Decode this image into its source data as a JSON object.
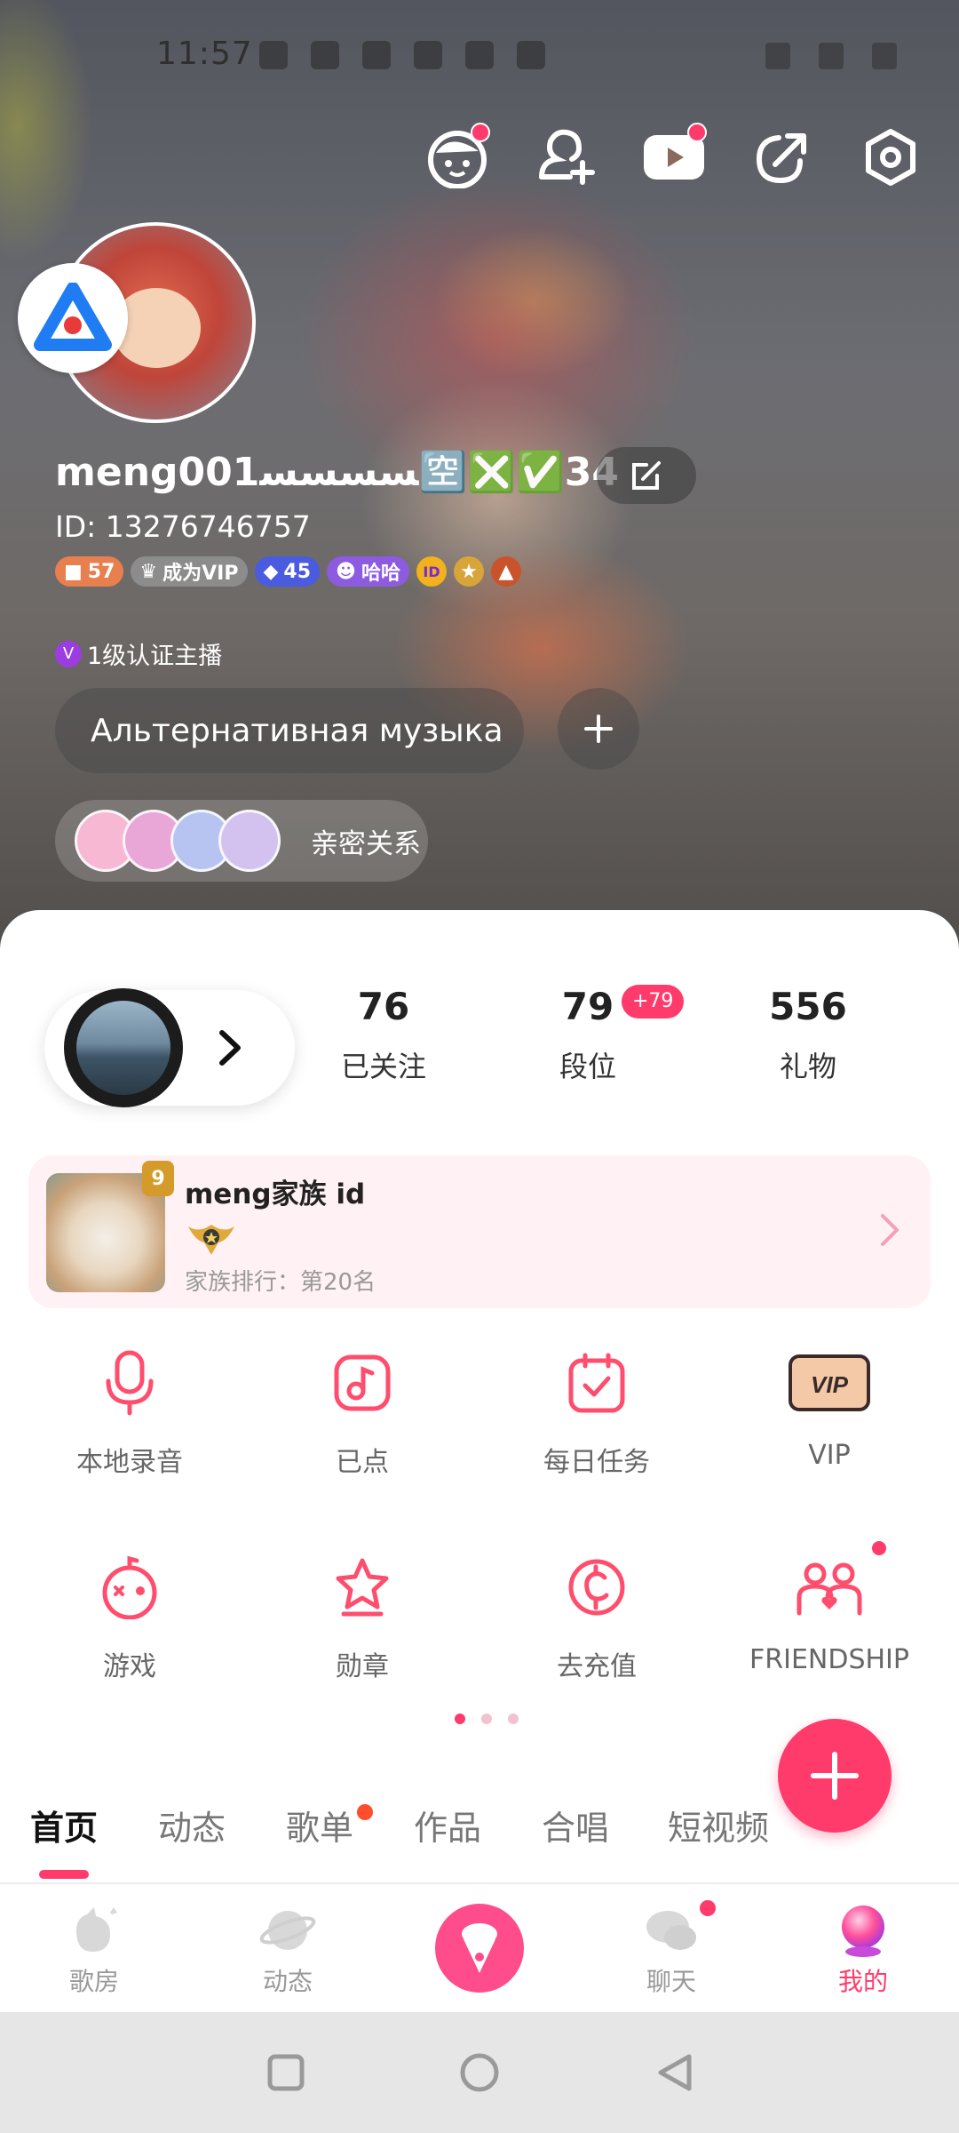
{
  "status_bar": {
    "time": "11:57"
  },
  "profile": {
    "username": "meng001ﺴﺴﺴﺴ🈳❎✅34",
    "id_text": "ID: 13276746757",
    "badges": {
      "level": "57",
      "vip": "成为VIP",
      "rank": "45",
      "tag": "哈哈",
      "id_badge": "ID"
    },
    "anchor": "1级认证主播",
    "anchor_icon": "V",
    "music_tag": "Альтернативная музыка",
    "intimate_label": "亲密关系"
  },
  "stats": [
    {
      "num": "76",
      "label": "已关注"
    },
    {
      "num": "79",
      "label": "段位",
      "badge": "+79"
    },
    {
      "num": "556",
      "label": "礼物"
    }
  ],
  "family": {
    "name": "meng家族 id",
    "level": "9",
    "rank": "家族排行：第20名"
  },
  "grid": [
    {
      "label": "本地录音",
      "icon": "microphone-icon"
    },
    {
      "label": "已点",
      "icon": "music-note-icon"
    },
    {
      "label": "每日任务",
      "icon": "calendar-check-icon"
    },
    {
      "label": "VIP",
      "icon": "vip-card-icon"
    },
    {
      "label": "游戏",
      "icon": "game-robot-icon"
    },
    {
      "label": "勋章",
      "icon": "medal-star-icon"
    },
    {
      "label": "去充值",
      "icon": "coin-icon"
    },
    {
      "label": "FRIENDSHIP",
      "icon": "friends-icon"
    }
  ],
  "tabs": [
    "首页",
    "动态",
    "歌单",
    "作品",
    "合唱",
    "短视频"
  ],
  "bottom_nav": [
    {
      "label": "歌房",
      "icon": "room-icon"
    },
    {
      "label": "动态",
      "icon": "planet-icon"
    },
    {
      "label": "聊天",
      "icon": "chat-icon"
    },
    {
      "label": "我的",
      "icon": "profile-orb-icon"
    }
  ],
  "colors": {
    "accent": "#ff3b6b",
    "family_bg": "#fff1f4"
  }
}
